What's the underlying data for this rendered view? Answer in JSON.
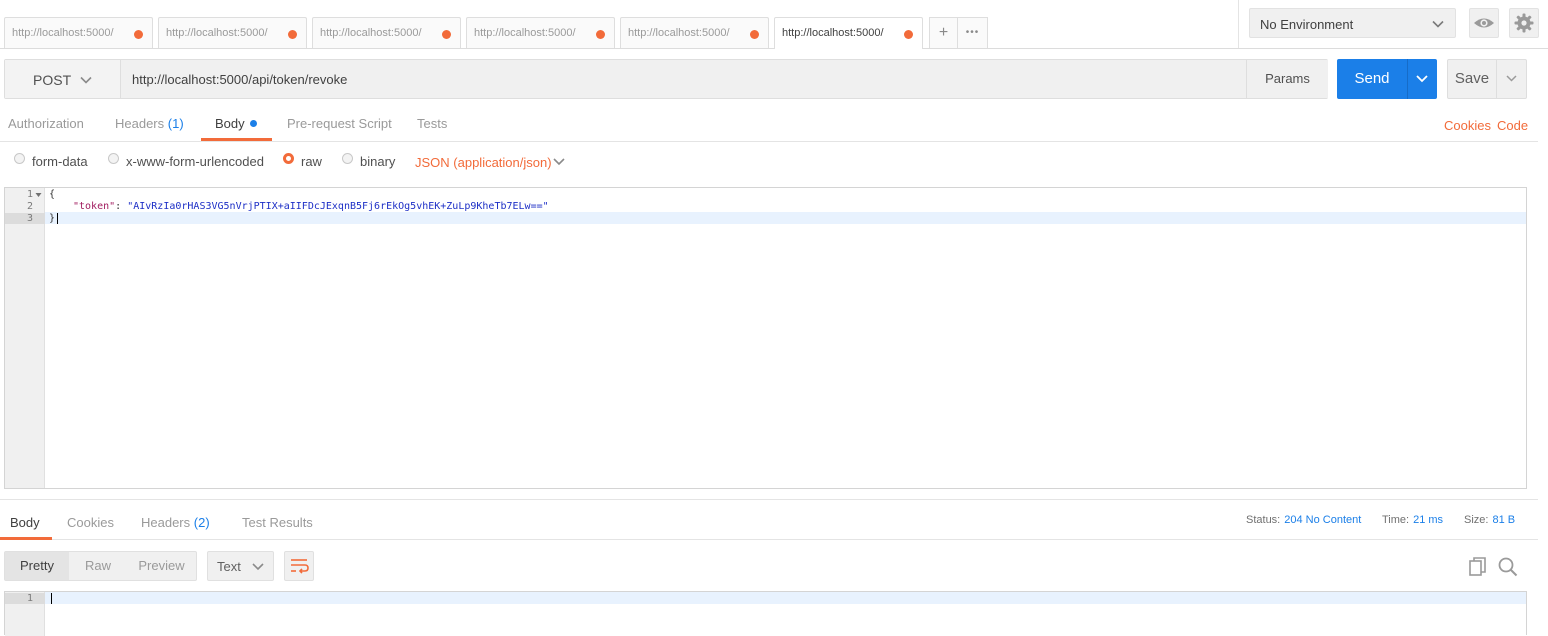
{
  "tabs": [
    {
      "label": "http://localhost:5000/",
      "active": false
    },
    {
      "label": "http://localhost:5000/",
      "active": false
    },
    {
      "label": "http://localhost:5000/",
      "active": false
    },
    {
      "label": "http://localhost:5000/",
      "active": false
    },
    {
      "label": "http://localhost:5000/",
      "active": false
    },
    {
      "label": "http://localhost:5000/",
      "active": true
    }
  ],
  "tab_actions": {
    "add": "+",
    "more": "•••"
  },
  "environment": {
    "selected": "No Environment"
  },
  "request": {
    "method": "POST",
    "url": "http://localhost:5000/api/token/revoke",
    "params_label": "Params",
    "send_label": "Send",
    "save_label": "Save"
  },
  "request_tabs": {
    "authorization": "Authorization",
    "headers": "Headers",
    "headers_count": "(1)",
    "body": "Body",
    "prerequest": "Pre-request Script",
    "tests": "Tests",
    "cookies": "Cookies",
    "code": "Code"
  },
  "body_modes": {
    "form_data": "form-data",
    "urlencoded": "x-www-form-urlencoded",
    "raw": "raw",
    "binary": "binary",
    "selected": "raw",
    "content_type": "JSON (application/json)"
  },
  "editor": {
    "line_numbers": [
      "1",
      "2",
      "3"
    ],
    "line1": "{",
    "key": "\"token\"",
    "colon": ": ",
    "value": "\"AIvRzIa0rHAS3VG5nVrjPTIX+aIIFDcJExqnB5Fj6rEkOg5vhEK+ZuLp9KheTb7ELw==\"",
    "line3": "}"
  },
  "response_tabs": {
    "body": "Body",
    "cookies": "Cookies",
    "headers": "Headers",
    "headers_count": "(2)",
    "test_results": "Test Results"
  },
  "response_status": {
    "status_label": "Status:",
    "status_value": "204 No Content",
    "time_label": "Time:",
    "time_value": "21 ms",
    "size_label": "Size:",
    "size_value": "81 B"
  },
  "response_view": {
    "pretty": "Pretty",
    "raw": "Raw",
    "preview": "Preview",
    "format": "Text",
    "line_numbers": [
      "1"
    ]
  },
  "colors": {
    "accent_orange": "#f26b3a",
    "primary_blue": "#1b7fe8"
  },
  "icons": {
    "eye": "eye-icon",
    "settings": "gear-icon",
    "copy": "copy-icon",
    "search": "search-icon",
    "wrap": "wrap-lines-icon"
  }
}
